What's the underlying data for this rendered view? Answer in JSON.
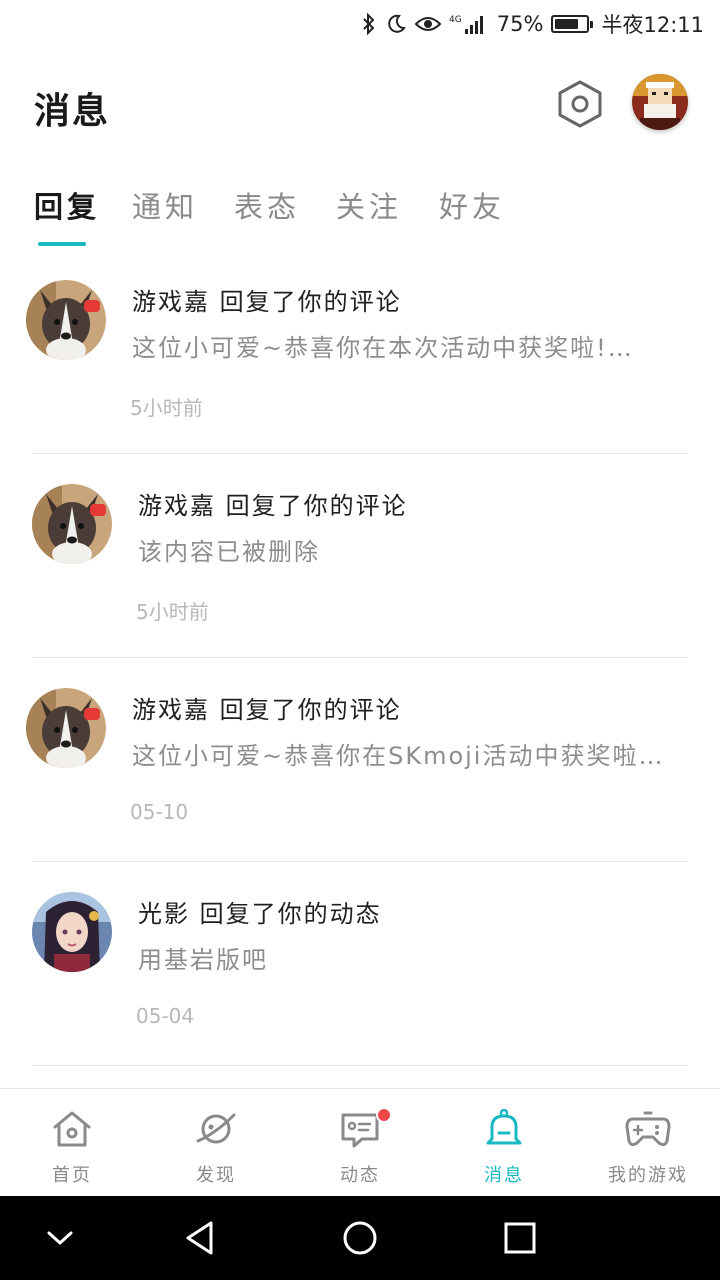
{
  "status_bar": {
    "battery_percent": "75%",
    "battery_level": 0.75,
    "time": "半夜12:11",
    "network": "4G",
    "icons": [
      "bluetooth-icon",
      "moon-icon",
      "eye-icon",
      "signal-icon",
      "battery-icon"
    ]
  },
  "header": {
    "title": "消息",
    "settings_icon": "settings-hexagon-icon",
    "avatar_icon": "user-avatar"
  },
  "tabs": [
    {
      "label": "回复",
      "active": true
    },
    {
      "label": "通知",
      "active": false
    },
    {
      "label": "表态",
      "active": false
    },
    {
      "label": "关注",
      "active": false
    },
    {
      "label": "好友",
      "active": false
    }
  ],
  "messages": [
    {
      "title": "游戏嘉 回复了你的评论",
      "content": "这位小可爱~恭喜你在本次活动中获奖啦!…",
      "time": "5小时前",
      "avatar": "dog"
    },
    {
      "title": "游戏嘉 回复了你的评论",
      "content": "该内容已被删除",
      "time": "5小时前",
      "avatar": "dog"
    },
    {
      "title": "游戏嘉 回复了你的评论",
      "content": "这位小可爱~恭喜你在SKmoji活动中获奖啦…",
      "time": "05-10",
      "avatar": "dog"
    },
    {
      "title": "光影 回复了你的动态",
      "content": "用基岩版吧",
      "time": "05-04",
      "avatar": "anime-girl"
    }
  ],
  "bottom_nav": [
    {
      "label": "首页",
      "icon": "home-icon",
      "active": false
    },
    {
      "label": "发现",
      "icon": "planet-icon",
      "active": false
    },
    {
      "label": "动态",
      "icon": "chat-card-icon",
      "active": false,
      "badge": true
    },
    {
      "label": "消息",
      "icon": "bell-icon",
      "active": true
    },
    {
      "label": "我的游戏",
      "icon": "gamepad-icon",
      "active": false
    }
  ],
  "colors": {
    "accent": "#19b9c4",
    "badge": "#f04848",
    "text_primary": "#1f1f1f",
    "text_secondary": "#8d8d8d",
    "text_time": "#b8b8b8"
  }
}
